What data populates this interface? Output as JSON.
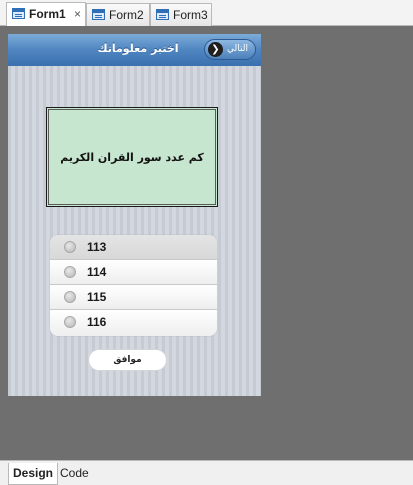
{
  "tabs": [
    {
      "label": "Form1",
      "close": "×"
    },
    {
      "label": "Form2"
    },
    {
      "label": "Form3"
    }
  ],
  "form": {
    "title": "اختبر معلوماتك",
    "next_button": "التالي",
    "question": "كم عدد سور القران الكريم",
    "options": [
      "113",
      "114",
      "115",
      "116"
    ],
    "ok_button": "موافق"
  },
  "view_tabs": [
    "Design",
    "Code"
  ],
  "colors": {
    "titlebar": "#4f85c0",
    "question_bg": "#c7e6d0",
    "workspace": "#6f6f6f"
  },
  "icons": {
    "tab_icon": "form-icon",
    "next_icon": "chevron-right-icon"
  }
}
